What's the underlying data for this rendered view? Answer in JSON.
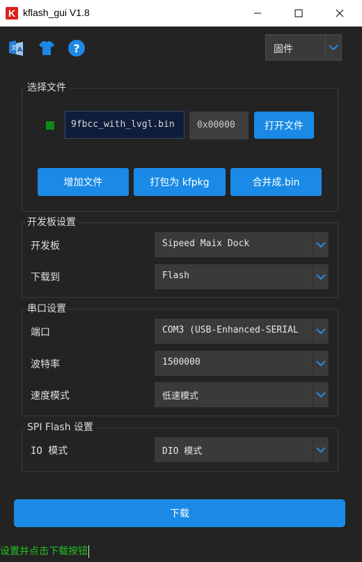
{
  "window": {
    "title": "kflash_gui V1.8",
    "logo_letter": "K",
    "minimize_glyph": "—",
    "maximize_glyph": "☐",
    "close_glyph": "✕"
  },
  "toolbar": {
    "icons": [
      "translate-icon",
      "tshirt-icon",
      "help-icon"
    ],
    "firmware_select": "固件"
  },
  "select_file": {
    "title": "选择文件",
    "file_name": "9fbcc_with_lvgl.bin",
    "address": "0x00000",
    "open_button": "打开文件",
    "add_button": "增加文件",
    "pack_button": "打包为 kfpkg",
    "merge_button": "合并成.bin"
  },
  "board": {
    "title": "开发板设置",
    "board_label": "开发板",
    "board_value": "Sipeed Maix Dock",
    "target_label": "下载到",
    "target_value": "Flash"
  },
  "serial": {
    "title": "串口设置",
    "port_label": "端口",
    "port_value": "COM3 (USB-Enhanced-SERIAL",
    "baud_label": "波特率",
    "baud_value": "1500000",
    "speed_label": "速度模式",
    "speed_value": "低速模式"
  },
  "spi": {
    "title": "SPI Flash 设置",
    "io_label": "IO 模式",
    "io_value": "DIO 模式"
  },
  "download_button": "下载",
  "status_text": "设置并点击下载按钮",
  "colors": {
    "accent": "#1a8ae6",
    "background": "#232323",
    "status_green": "#20c020",
    "led_green": "#0f8a14"
  }
}
